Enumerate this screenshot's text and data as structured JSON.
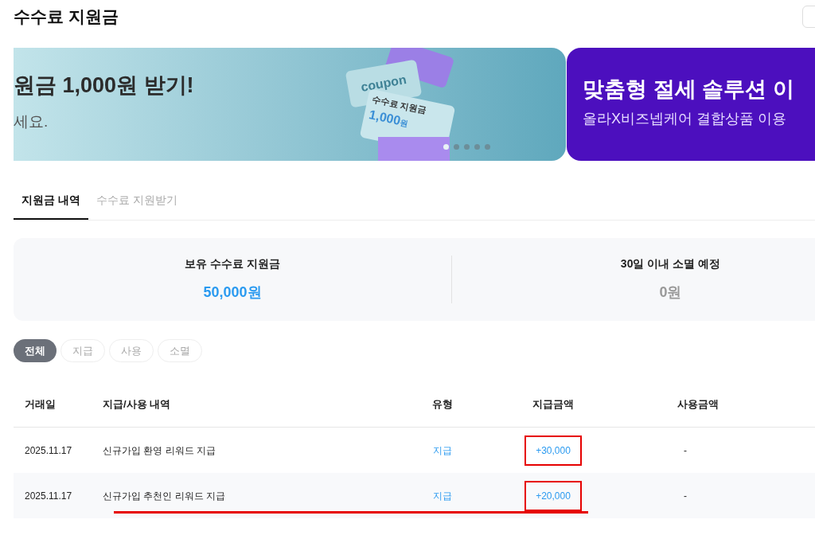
{
  "page_title": "수수료 지원금",
  "banners": [
    {
      "kind": "coupon",
      "headline": "원금 1,000원 받기!",
      "subline": "세요.",
      "art": {
        "back_coupon": "coupon",
        "front_title": "수수료 지원금",
        "front_amount": "1,000",
        "front_unit": "원"
      },
      "dots": [
        {
          "selected": true
        },
        {
          "selected": false
        },
        {
          "selected": false
        },
        {
          "selected": false
        },
        {
          "selected": false
        }
      ]
    },
    {
      "kind": "promo",
      "headline": "맞춤형 절세 솔루션 이",
      "subline": "올라X비즈넵케어 결합상품 이용"
    }
  ],
  "tabs": [
    {
      "label": "지원금 내역",
      "selected": true
    },
    {
      "label": "수수료 지원받기",
      "selected": false
    }
  ],
  "summary": [
    {
      "label": "보유 수수료 지원금",
      "value": "50,000원",
      "kind": "positive"
    },
    {
      "label": "30일 이내 소멸 예정",
      "value": "0원",
      "kind": "zero"
    }
  ],
  "filters": [
    {
      "label": "전체",
      "selected": true
    },
    {
      "label": "지급",
      "selected": false
    },
    {
      "label": "사용",
      "selected": false
    },
    {
      "label": "소멸",
      "selected": false
    }
  ],
  "table": {
    "columns": [
      "거래일",
      "지급/사용 내역",
      "유형",
      "지급금액",
      "사용금액"
    ],
    "rows": [
      {
        "date": "2025.11.17",
        "description": "신규가입 환영 리워드 지급",
        "type": "지급",
        "paid": "+30,000",
        "used": "-",
        "amount_boxed": true,
        "underlined": false
      },
      {
        "date": "2025.11.17",
        "description": "신규가입 추천인 리워드 지급",
        "type": "지급",
        "paid": "+20,000",
        "used": "-",
        "amount_boxed": true,
        "underlined": true
      }
    ]
  }
}
